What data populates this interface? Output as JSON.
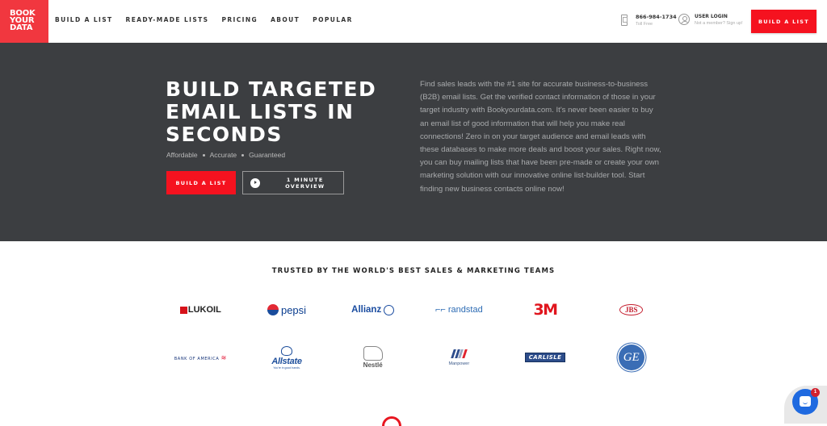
{
  "header": {
    "logo_lines": [
      "BOOK",
      "YOUR",
      "DATA"
    ],
    "nav": [
      "BUILD A LIST",
      "READY-MADE LISTS",
      "PRICING",
      "ABOUT",
      "POPULAR"
    ],
    "phone": {
      "icon": "mobile-phone-icon",
      "number": "866-984-1734",
      "sub": "Toll Free"
    },
    "login": {
      "icon": "user-circle-icon",
      "title": "USER LOGIN",
      "sub": "Not a member? Sign up!"
    },
    "cta_label": "BUILD A LIST"
  },
  "hero": {
    "title_lines": [
      "BUILD TARGETED",
      "EMAIL LISTS IN",
      "SECONDS"
    ],
    "tags": [
      "Affordable",
      "Accurate",
      "Guaranteed"
    ],
    "primary_button": "BUILD A LIST",
    "secondary_button": "1 MINUTE OVERVIEW",
    "secondary_icon": "play-icon",
    "description": "Find sales leads with the #1 site for accurate business-to-business (B2B) email lists. Get the verified contact information of those in your target industry with Bookyourdata.com. It's never been easier to buy an email list of good information that will help you make real connections! Zero in on your target audience and email leads with these databases to make more deals and boost your sales. Right now, you can buy mailing lists that have been pre-made or create your own marketing solution with our innovative online list-builder tool. Start finding new business contacts online now!"
  },
  "trusted": {
    "heading": "TRUSTED BY THE WORLD'S BEST SALES & MARKETING TEAMS",
    "row1": [
      "LUKOIL",
      "pepsi",
      "Allianz",
      "randstad",
      "3M",
      "JBS"
    ],
    "row2": [
      "BANK OF AMERICA",
      "Allstate",
      "Nestlé",
      "Manpower",
      "CARLISLE",
      "GE"
    ],
    "allstate_tagline": "You're in good hands."
  },
  "chat": {
    "icon": "chat-bubble-icon",
    "badge": "1"
  },
  "colors": {
    "brand_red": "#f1373f",
    "cta_red": "#f5121f",
    "hero_bg": "#3c3e41",
    "chat_blue": "#1f6ae0"
  }
}
